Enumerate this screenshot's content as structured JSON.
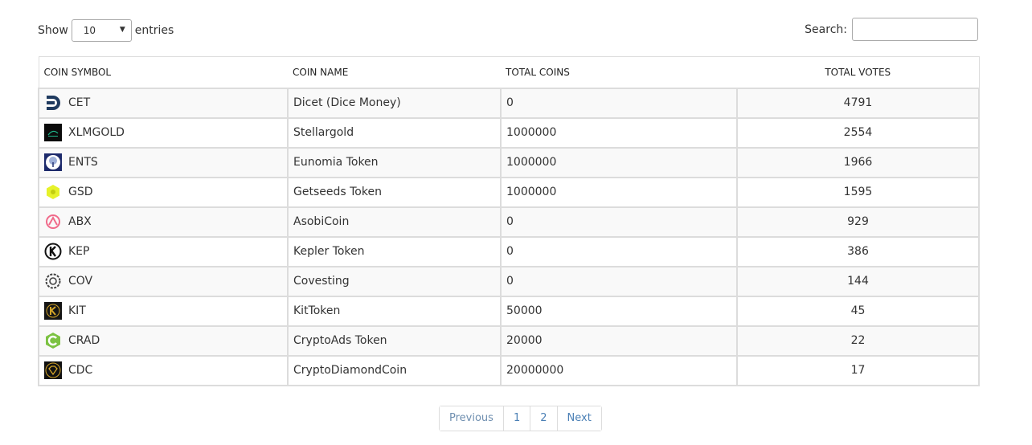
{
  "controls": {
    "show_label": "Show",
    "entries_label": "entries",
    "page_length": "10",
    "search_label": "Search:",
    "search_value": ""
  },
  "table": {
    "headers": {
      "symbol": "COIN SYMBOL",
      "name": "COIN NAME",
      "total_coins": "TOTAL COINS",
      "total_votes": "TOTAL VOTES"
    },
    "rows": [
      {
        "symbol": "CET",
        "name": "Dicet (Dice Money)",
        "total_coins": "0",
        "total_votes": "4791",
        "icon": "dicet-logo-icon"
      },
      {
        "symbol": "XLMGOLD",
        "name": "Stellargold",
        "total_coins": "1000000",
        "total_votes": "2554",
        "icon": "stellargold-logo-icon"
      },
      {
        "symbol": "ENTS",
        "name": "Eunomia Token",
        "total_coins": "1000000",
        "total_votes": "1966",
        "icon": "eunomia-tree-logo-icon"
      },
      {
        "symbol": "GSD",
        "name": "Getseeds Token",
        "total_coins": "1000000",
        "total_votes": "1595",
        "icon": "getseeds-logo-icon"
      },
      {
        "symbol": "ABX",
        "name": "AsobiCoin",
        "total_coins": "0",
        "total_votes": "929",
        "icon": "asobicoin-logo-icon"
      },
      {
        "symbol": "KEP",
        "name": "Kepler Token",
        "total_coins": "0",
        "total_votes": "386",
        "icon": "kepler-logo-icon"
      },
      {
        "symbol": "COV",
        "name": "Covesting",
        "total_coins": "0",
        "total_votes": "144",
        "icon": "covesting-logo-icon"
      },
      {
        "symbol": "KIT",
        "name": "KitToken",
        "total_coins": "50000",
        "total_votes": "45",
        "icon": "kittoken-logo-icon"
      },
      {
        "symbol": "CRAD",
        "name": "CryptoAds Token",
        "total_coins": "20000",
        "total_votes": "22",
        "icon": "cryptoads-logo-icon"
      },
      {
        "symbol": "CDC",
        "name": "CryptoDiamondCoin",
        "total_coins": "20000000",
        "total_votes": "17",
        "icon": "cryptodiamond-logo-icon"
      }
    ]
  },
  "pagination": {
    "previous": "Previous",
    "pages": [
      "1",
      "2"
    ],
    "next": "Next"
  }
}
